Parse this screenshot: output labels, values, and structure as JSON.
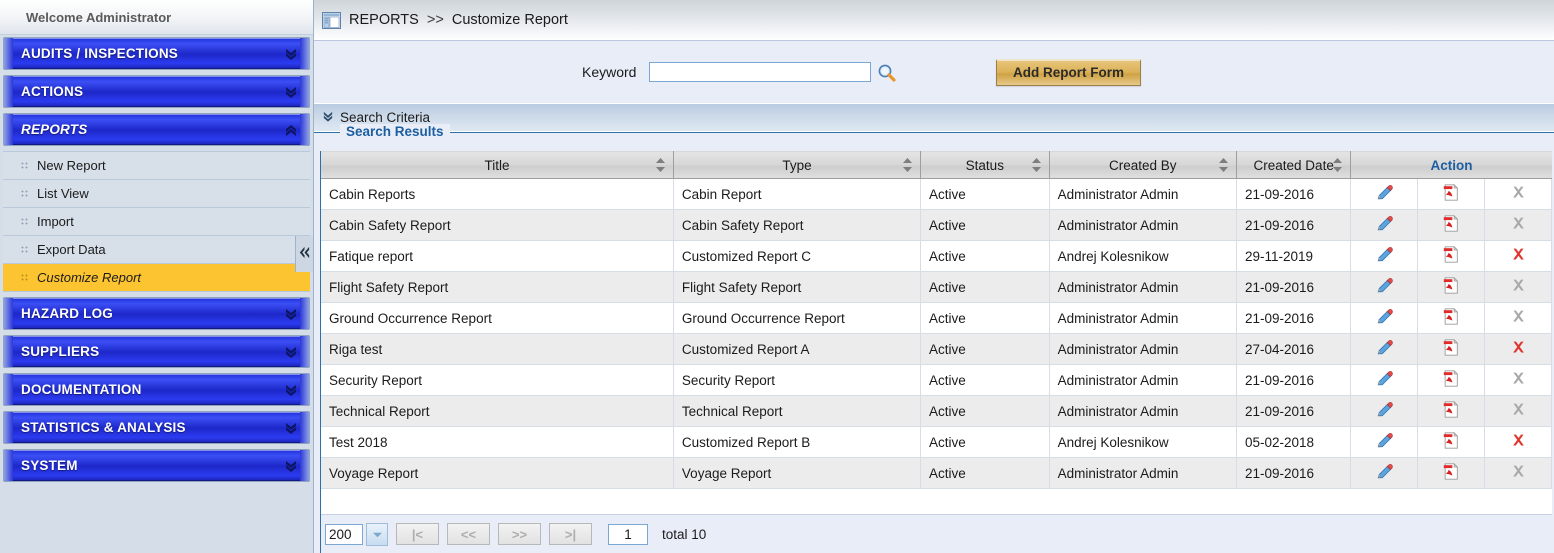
{
  "sidebar": {
    "welcome": "Welcome  Administrator",
    "collapse_icon": "chevron-double-left-icon",
    "groups": [
      {
        "label": "AUDITS / INSPECTIONS",
        "state": "collapsed",
        "icon": "chevron-double-down-icon"
      },
      {
        "label": "ACTIONS",
        "state": "collapsed",
        "icon": "chevron-double-down-icon"
      },
      {
        "label": "REPORTS",
        "state": "expanded",
        "icon": "chevron-double-up-icon"
      },
      {
        "label": "HAZARD LOG",
        "state": "collapsed",
        "icon": "chevron-double-down-icon"
      },
      {
        "label": "SUPPLIERS",
        "state": "collapsed",
        "icon": "chevron-double-down-icon"
      },
      {
        "label": "DOCUMENTATION",
        "state": "collapsed",
        "icon": "chevron-double-down-icon"
      },
      {
        "label": "STATISTICS & ANALYSIS",
        "state": "collapsed",
        "icon": "chevron-double-down-icon"
      },
      {
        "label": "SYSTEM",
        "state": "collapsed",
        "icon": "chevron-double-down-icon"
      }
    ],
    "reports_items": [
      {
        "label": "New Report",
        "selected": false
      },
      {
        "label": "List View",
        "selected": false
      },
      {
        "label": "Import",
        "selected": false
      },
      {
        "label": "Export Data",
        "selected": false
      },
      {
        "label": "Customize Report",
        "selected": true
      }
    ]
  },
  "breadcrumb": {
    "icon": "panel-window-icon",
    "root": "REPORTS",
    "separator": ">>",
    "current": "Customize Report"
  },
  "search": {
    "keyword_label": "Keyword",
    "keyword_value": "",
    "keyword_placeholder": "",
    "search_icon": "magnifier-icon",
    "add_button": "Add Report Form"
  },
  "criteria": {
    "label": "Search Criteria",
    "icon": "chevron-double-down-icon"
  },
  "results": {
    "legend": "Search Results",
    "columns": [
      {
        "label": "Title",
        "sortable": true
      },
      {
        "label": "Type",
        "sortable": true
      },
      {
        "label": "Status",
        "sortable": true
      },
      {
        "label": "Created By",
        "sortable": true
      },
      {
        "label": "Created Date",
        "sortable": true
      },
      {
        "label": "Action",
        "sortable": false
      }
    ],
    "rows": [
      {
        "title": "Cabin Reports",
        "type": "Cabin Report",
        "status": "Active",
        "created_by": "Administrator Admin",
        "created_date": "21-09-2016",
        "delete_enabled": false
      },
      {
        "title": "Cabin Safety Report",
        "type": "Cabin Safety Report",
        "status": "Active",
        "created_by": "Administrator Admin",
        "created_date": "21-09-2016",
        "delete_enabled": false
      },
      {
        "title": "Fatique report",
        "type": "Customized Report C",
        "status": "Active",
        "created_by": "Andrej Kolesnikow",
        "created_date": "29-11-2019",
        "delete_enabled": true
      },
      {
        "title": "Flight Safety Report",
        "type": "Flight Safety Report",
        "status": "Active",
        "created_by": "Administrator Admin",
        "created_date": "21-09-2016",
        "delete_enabled": false
      },
      {
        "title": "Ground Occurrence Report",
        "type": "Ground Occurrence Report",
        "status": "Active",
        "created_by": "Administrator Admin",
        "created_date": "21-09-2016",
        "delete_enabled": false
      },
      {
        "title": "Riga test",
        "type": "Customized Report A",
        "status": "Active",
        "created_by": "Administrator Admin",
        "created_date": "27-04-2016",
        "delete_enabled": true
      },
      {
        "title": "Security Report",
        "type": "Security Report",
        "status": "Active",
        "created_by": "Administrator Admin",
        "created_date": "21-09-2016",
        "delete_enabled": false
      },
      {
        "title": "Technical Report",
        "type": "Technical Report",
        "status": "Active",
        "created_by": "Administrator Admin",
        "created_date": "21-09-2016",
        "delete_enabled": false
      },
      {
        "title": "Test 2018",
        "type": "Customized Report B",
        "status": "Active",
        "created_by": "Andrej Kolesnikow",
        "created_date": "05-02-2018",
        "delete_enabled": true
      },
      {
        "title": "Voyage Report",
        "type": "Voyage Report",
        "status": "Active",
        "created_by": "Administrator Admin",
        "created_date": "21-09-2016",
        "delete_enabled": false
      }
    ],
    "action_icons": {
      "edit": "pencil-icon",
      "export": "pdf-icon",
      "delete": "delete-x-icon"
    }
  },
  "pagination": {
    "page_size": "200",
    "dropdown_icon": "chevron-down-icon",
    "first": "|<",
    "prev": "<<",
    "next": ">>",
    "last": ">|",
    "page_number": "1",
    "total_label": "total 10"
  },
  "colors": {
    "nav_blue": "#1f2fd8",
    "selected_gold": "#fbc430",
    "legend_blue": "#1d5fa0",
    "button_gold": "#dcb35b",
    "delete_red": "#e04b4b"
  }
}
